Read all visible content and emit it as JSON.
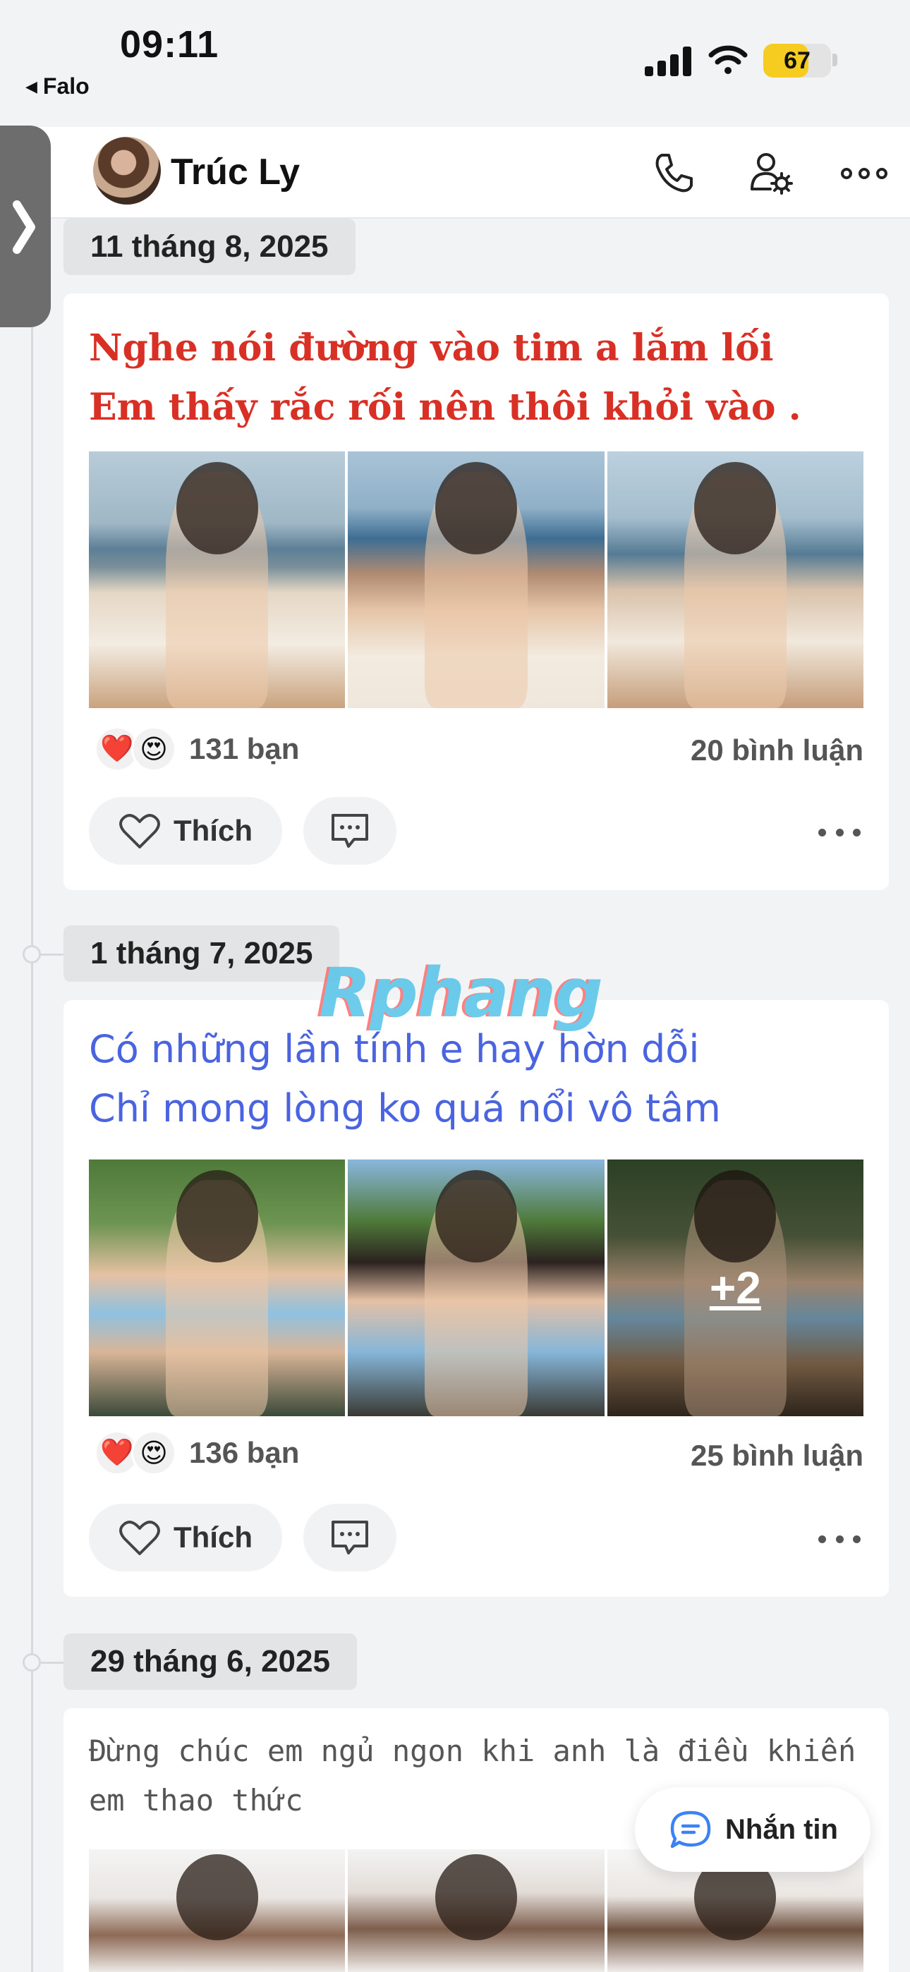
{
  "status_bar": {
    "time": "09:11",
    "back_app": "Falo",
    "battery": "67"
  },
  "header": {
    "contact_name": "Trúc Ly"
  },
  "posts": [
    {
      "date": "11 tháng 8, 2025",
      "caption_lines": [
        "Nghe nói đường vào tim a lắm lối",
        "Em thấy rắc rối nên thôi khỏi vào ."
      ],
      "reaction_count": "131 bạn",
      "comment_count": "20 bình luận",
      "like_label": "Thích"
    },
    {
      "date": "1 tháng 7, 2025",
      "caption_lines": [
        "Có những lần tính e hay hờn dỗi",
        "Chỉ mong lòng ko quá nổi vô tâm"
      ],
      "reaction_count": "136 bạn",
      "comment_count": "25 bình luận",
      "like_label": "Thích",
      "more_photos": "+2"
    },
    {
      "date": "29 tháng 6, 2025",
      "caption_lines": [
        "Đừng chúc em ngủ ngon khi anh là điều khiến",
        "em thao thức"
      ]
    }
  ],
  "reaction_icons": [
    "❤️",
    "😍"
  ],
  "watermark": "Rphang",
  "message_button": "Nhắn tin",
  "colors": {
    "caption_red": "#d93025",
    "caption_blue": "#4a63e0",
    "battery_yellow": "#f5cc1f"
  },
  "icons": [
    "phone-icon",
    "profile-settings-icon",
    "more-icon",
    "heart-icon",
    "comment-icon",
    "chat-bubble-icon",
    "chevron-right-icon",
    "signal-icon",
    "wifi-icon",
    "battery-icon"
  ]
}
